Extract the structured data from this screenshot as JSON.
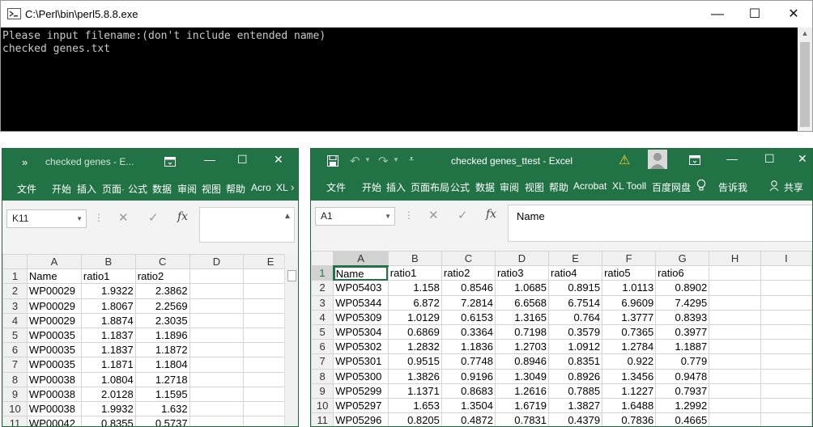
{
  "console": {
    "title": "C:\\Perl\\bin\\perl5.8.8.exe",
    "lines": [
      "Please input filename:(don't include entended name)",
      "checked genes.txt"
    ]
  },
  "win_controls": {
    "minimize": "—",
    "maximize": "☐",
    "close": "✕"
  },
  "left_excel": {
    "title": "checked genes - E...",
    "qat": "»",
    "tabs": [
      "文件",
      "开始",
      "插入",
      "页面·",
      "公式",
      "数据",
      "审阅",
      "视图",
      "帮助",
      "Acro",
      "XL"
    ],
    "tab_more": "›",
    "name_box": "K11",
    "formula_value": "",
    "fx": "fx",
    "col_headers": [
      "A",
      "B",
      "C",
      "D",
      "E"
    ],
    "rows": [
      {
        "n": "1",
        "cells": [
          "Name",
          "ratio1",
          "ratio2",
          "",
          ""
        ]
      },
      {
        "n": "2",
        "cells": [
          "WP00029",
          "1.9322",
          "2.3862",
          "",
          ""
        ]
      },
      {
        "n": "3",
        "cells": [
          "WP00029",
          "1.8067",
          "2.2569",
          "",
          ""
        ]
      },
      {
        "n": "4",
        "cells": [
          "WP00029",
          "1.8874",
          "2.3035",
          "",
          ""
        ]
      },
      {
        "n": "5",
        "cells": [
          "WP00035",
          "1.1837",
          "1.1896",
          "",
          ""
        ]
      },
      {
        "n": "6",
        "cells": [
          "WP00035",
          "1.1837",
          "1.1872",
          "",
          ""
        ]
      },
      {
        "n": "7",
        "cells": [
          "WP00035",
          "1.1871",
          "1.1804",
          "",
          ""
        ]
      },
      {
        "n": "8",
        "cells": [
          "WP00038",
          "1.0804",
          "1.2718",
          "",
          ""
        ]
      },
      {
        "n": "9",
        "cells": [
          "WP00038",
          "2.0128",
          "1.1595",
          "",
          ""
        ]
      },
      {
        "n": "10",
        "cells": [
          "WP00038",
          "1.9932",
          "1.632",
          "",
          ""
        ]
      },
      {
        "n": "11",
        "cells": [
          "WP00042",
          "0.8355",
          "0.5737",
          "",
          ""
        ]
      }
    ]
  },
  "right_excel": {
    "title": "checked genes_ttest  -  Excel",
    "warning_icon": "⚠",
    "tabs": [
      "文件",
      "开始",
      "插入",
      "页面布局",
      "公式",
      "数据",
      "审阅",
      "视图",
      "帮助",
      "Acrobat",
      "XL Tooll",
      "百度网盘"
    ],
    "tell_me": "告诉我",
    "share": "共享",
    "name_box": "A1",
    "formula_value": "Name",
    "fx": "fx",
    "col_headers": [
      "A",
      "B",
      "C",
      "D",
      "E",
      "F",
      "G",
      "H",
      "I"
    ],
    "rows": [
      {
        "n": "1",
        "cells": [
          "Name",
          "ratio1",
          "ratio2",
          "ratio3",
          "ratio4",
          "ratio5",
          "ratio6",
          "",
          ""
        ]
      },
      {
        "n": "2",
        "cells": [
          "WP05403",
          "1.158",
          "0.8546",
          "1.0685",
          "0.8915",
          "1.0113",
          "0.8902",
          "",
          ""
        ]
      },
      {
        "n": "3",
        "cells": [
          "WP05344",
          "6.872",
          "7.2814",
          "6.6568",
          "6.7514",
          "6.9609",
          "7.4295",
          "",
          ""
        ]
      },
      {
        "n": "4",
        "cells": [
          "WP05309",
          "1.0129",
          "0.6153",
          "1.3165",
          "0.764",
          "1.3777",
          "0.8393",
          "",
          ""
        ]
      },
      {
        "n": "5",
        "cells": [
          "WP05304",
          "0.6869",
          "0.3364",
          "0.7198",
          "0.3579",
          "0.7365",
          "0.3977",
          "",
          ""
        ]
      },
      {
        "n": "6",
        "cells": [
          "WP05302",
          "1.2832",
          "1.1836",
          "1.2703",
          "1.0912",
          "1.2784",
          "1.1887",
          "",
          ""
        ]
      },
      {
        "n": "7",
        "cells": [
          "WP05301",
          "0.9515",
          "0.7748",
          "0.8946",
          "0.8351",
          "0.922",
          "0.779",
          "",
          ""
        ]
      },
      {
        "n": "8",
        "cells": [
          "WP05300",
          "1.3826",
          "0.9196",
          "1.3049",
          "0.8926",
          "1.3456",
          "0.9478",
          "",
          ""
        ]
      },
      {
        "n": "9",
        "cells": [
          "WP05299",
          "1.1371",
          "0.8683",
          "1.2616",
          "0.7885",
          "1.1227",
          "0.7937",
          "",
          ""
        ]
      },
      {
        "n": "10",
        "cells": [
          "WP05297",
          "1.653",
          "1.3504",
          "1.6719",
          "1.3827",
          "1.6488",
          "1.2992",
          "",
          ""
        ]
      },
      {
        "n": "11",
        "cells": [
          "WP05296",
          "0.8205",
          "0.4872",
          "0.7831",
          "0.4379",
          "0.7836",
          "0.4665",
          "",
          ""
        ]
      }
    ]
  },
  "colors": {
    "excel_green": "#217346",
    "console_bg": "#000000"
  }
}
